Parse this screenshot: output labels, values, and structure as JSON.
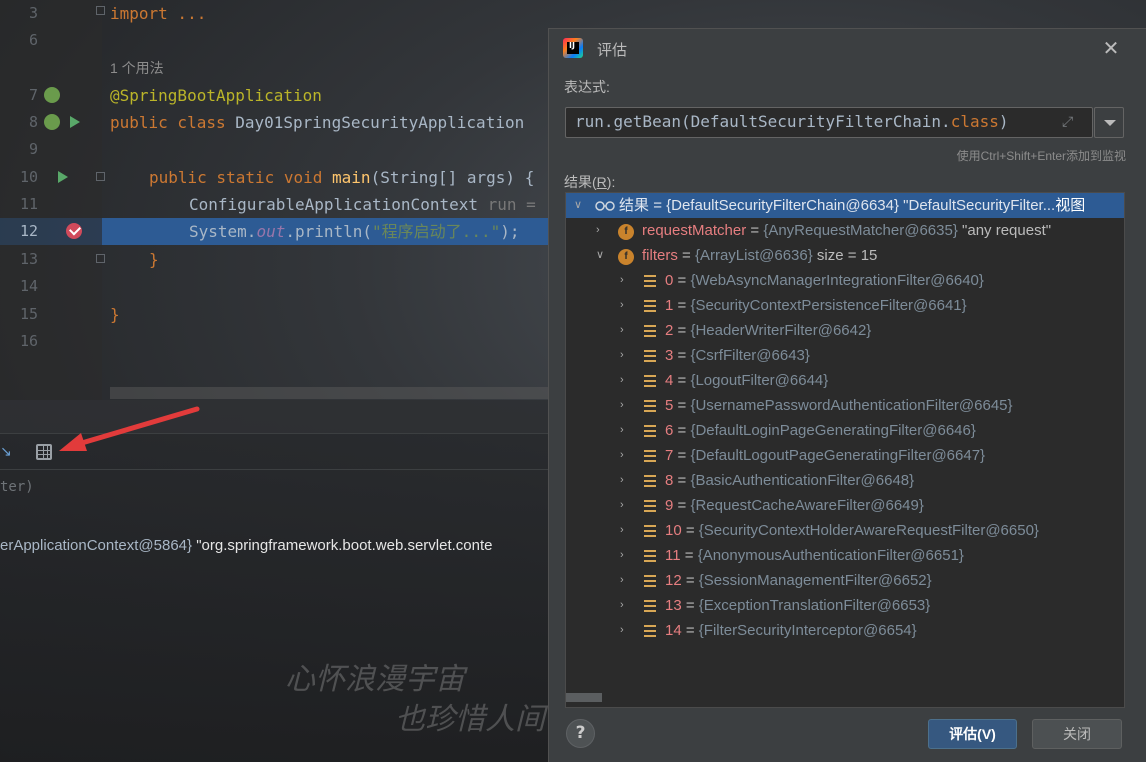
{
  "editor": {
    "line_numbers": [
      "3",
      "6",
      "7",
      "8",
      "9",
      "10",
      "11",
      "12",
      "13",
      "14",
      "15",
      "16"
    ],
    "import_line": "import ...",
    "usage_hint": "1 个用法",
    "annotation": "@SpringBootApplication",
    "class_kw": "public class",
    "class_name": "Day01SpringSecurityApplication",
    "main_kw": "public static void",
    "main_name": "main",
    "main_args": "(String[] args) {",
    "ctx_type": "ConfigurableApplicationContext",
    "ctx_var": "run =",
    "sys": "System.",
    "out": "out",
    "println": ".println(",
    "print_str": "\"程序启动了...\"",
    "print_end": ");",
    "close_inner": "}",
    "close_outer": "}"
  },
  "bottom_panel": {
    "expr_fragment": "ter)",
    "var_fragment_a": "erApplicationContext@5864}",
    "var_fragment_b": "\"org.springframework.boot.web.servlet.conte",
    "calligraphy_line1": "心怀浪漫宇宙",
    "calligraphy_line2": "也珍惜人间"
  },
  "dialog": {
    "title": "评估",
    "expression_label": "表达式:",
    "expression": {
      "prefix": "run.getBean(DefaultSecurityFilterChain.",
      "keyword": "class",
      "suffix": ")"
    },
    "watch_hint": "使用Ctrl+Shift+Enter添加到监视",
    "result_label_main": "结果(",
    "result_label_mn": "R",
    "result_label_end": "):",
    "root": {
      "name": "结果",
      "value": "{DefaultSecurityFilterChain@6634}",
      "string": "\"DefaultSecurityFilter...",
      "view": "视图"
    },
    "request_matcher": {
      "name": "requestMatcher",
      "value": "{AnyRequestMatcher@6635}",
      "string": "\"any request\""
    },
    "filters": {
      "name": "filters",
      "value": "{ArrayList@6636}",
      "size": "size = 15"
    },
    "filter_items": [
      {
        "index": "0",
        "value": "{WebAsyncManagerIntegrationFilter@6640}"
      },
      {
        "index": "1",
        "value": "{SecurityContextPersistenceFilter@6641}"
      },
      {
        "index": "2",
        "value": "{HeaderWriterFilter@6642}"
      },
      {
        "index": "3",
        "value": "{CsrfFilter@6643}"
      },
      {
        "index": "4",
        "value": "{LogoutFilter@6644}"
      },
      {
        "index": "5",
        "value": "{UsernamePasswordAuthenticationFilter@6645}"
      },
      {
        "index": "6",
        "value": "{DefaultLoginPageGeneratingFilter@6646}"
      },
      {
        "index": "7",
        "value": "{DefaultLogoutPageGeneratingFilter@6647}"
      },
      {
        "index": "8",
        "value": "{BasicAuthenticationFilter@6648}"
      },
      {
        "index": "9",
        "value": "{RequestCacheAwareFilter@6649}"
      },
      {
        "index": "10",
        "value": "{SecurityContextHolderAwareRequestFilter@6650}"
      },
      {
        "index": "11",
        "value": "{AnonymousAuthenticationFilter@6651}"
      },
      {
        "index": "12",
        "value": "{SessionManagementFilter@6652}"
      },
      {
        "index": "13",
        "value": "{ExceptionTranslationFilter@6653}"
      },
      {
        "index": "14",
        "value": "{FilterSecurityInterceptor@6654}"
      }
    ],
    "help_label": "?",
    "evaluate_label": "评估(V)",
    "close_label": "关闭"
  }
}
